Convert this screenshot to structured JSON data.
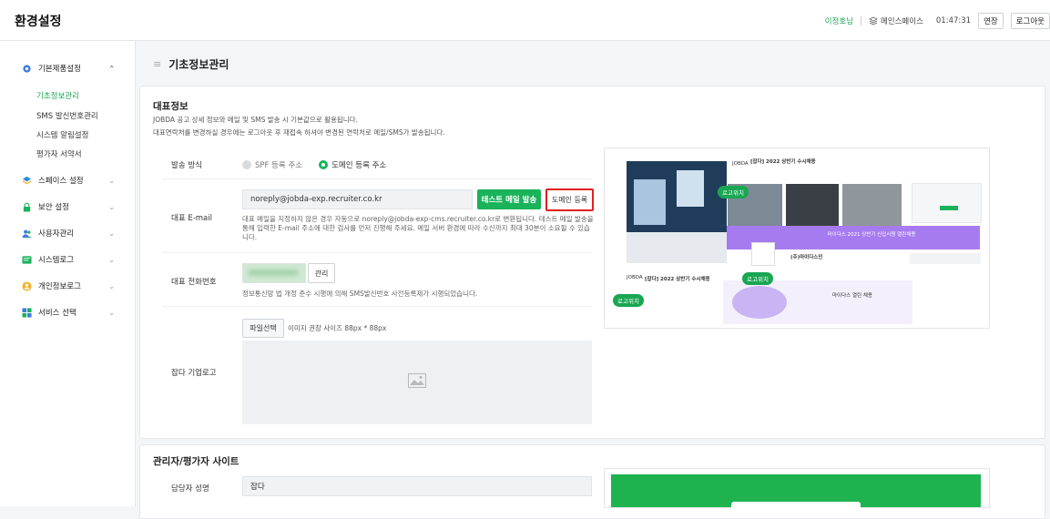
{
  "app": {
    "title": "환경설정"
  },
  "header": {
    "user": "이정호님",
    "workspace": "메인스페이스",
    "timer": "01:47:31",
    "extend_label": "연장",
    "logout_label": "로그아웃"
  },
  "sidebar": {
    "items": [
      {
        "label": "기본제품설정",
        "icon": "gear-icon",
        "expanded": true
      },
      {
        "label": "스페이스 설정",
        "icon": "space-icon"
      },
      {
        "label": "보안 설정",
        "icon": "lock-icon"
      },
      {
        "label": "사용자관리",
        "icon": "users-icon"
      },
      {
        "label": "시스템로그",
        "icon": "log-icon"
      },
      {
        "label": "개인정보로그",
        "icon": "privacy-icon"
      },
      {
        "label": "서비스 선택",
        "icon": "grid-icon"
      }
    ],
    "sub_items": [
      "기초정보관리",
      "SMS 발신번호관리",
      "시스템 알림설정",
      "평가자 서약서"
    ]
  },
  "page": {
    "title": "기초정보관리"
  },
  "section_main": {
    "title": "대표정보",
    "desc1": "JOBDA 공고 상세 정보와 메일 및 SMS 발송 시 기본값으로 활용됩니다.",
    "desc2": "대표연락처를 변경하실 경우에는 로그아웃 후 재접속 하셔야 변경된 연락처로 메일/SMS가 발송됩니다."
  },
  "send_method": {
    "label": "발송 방식",
    "option_spf": "SPF 등록 주소",
    "option_domain": "도메인 등록 주소",
    "selected": "도메인 등록 주소"
  },
  "email": {
    "label": "대표 E-mail",
    "value": "noreply@jobda-exp.recruiter.co.kr",
    "test_button": "테스트 메일 발송",
    "domain_button": "도메인 등록",
    "help1": "대표 메일을 지정하지 않은 경우 자동으로 noreply@jobda-exp-cms.recruiter.co.kr로 변환됩니다. 테스트 메일 발송을",
    "help2": "통해 입력한 E-mail 주소에 대한 검사를 먼저 진행해 주세요. 메일 서버 환경에 따라 수신까지 최대 30분이 소요될 수 있습",
    "help3": "니다."
  },
  "phone": {
    "label": "대표 전화번호",
    "manage_button": "관리",
    "help": "정보통신망 법 개정 준수 시행에 의해 SMS발신번호 사전등록제가 시행되었습니다."
  },
  "logo": {
    "label": "잡다 기업로고",
    "file_button": "파일선택",
    "size_hint": "이미지 권장 사이즈 88px * 88px"
  },
  "preview": {
    "logo_tag": "로고위치",
    "jobda": "JOBDA",
    "title1": "[잡다] 2022 상반기 수시채용",
    "banner": "마이다스 2021 상반기 신입사원 열린채용",
    "company": "(주)마이다스인",
    "card_title": "마이다스 열린 채용"
  },
  "section_admin": {
    "title": "관리자/평가자 사이트",
    "manager_label": "담당자 성명",
    "manager_value": "잡다"
  },
  "colors": {
    "accent": "#19b35a",
    "highlight": "#e02020",
    "banner": "#a77bf0"
  }
}
